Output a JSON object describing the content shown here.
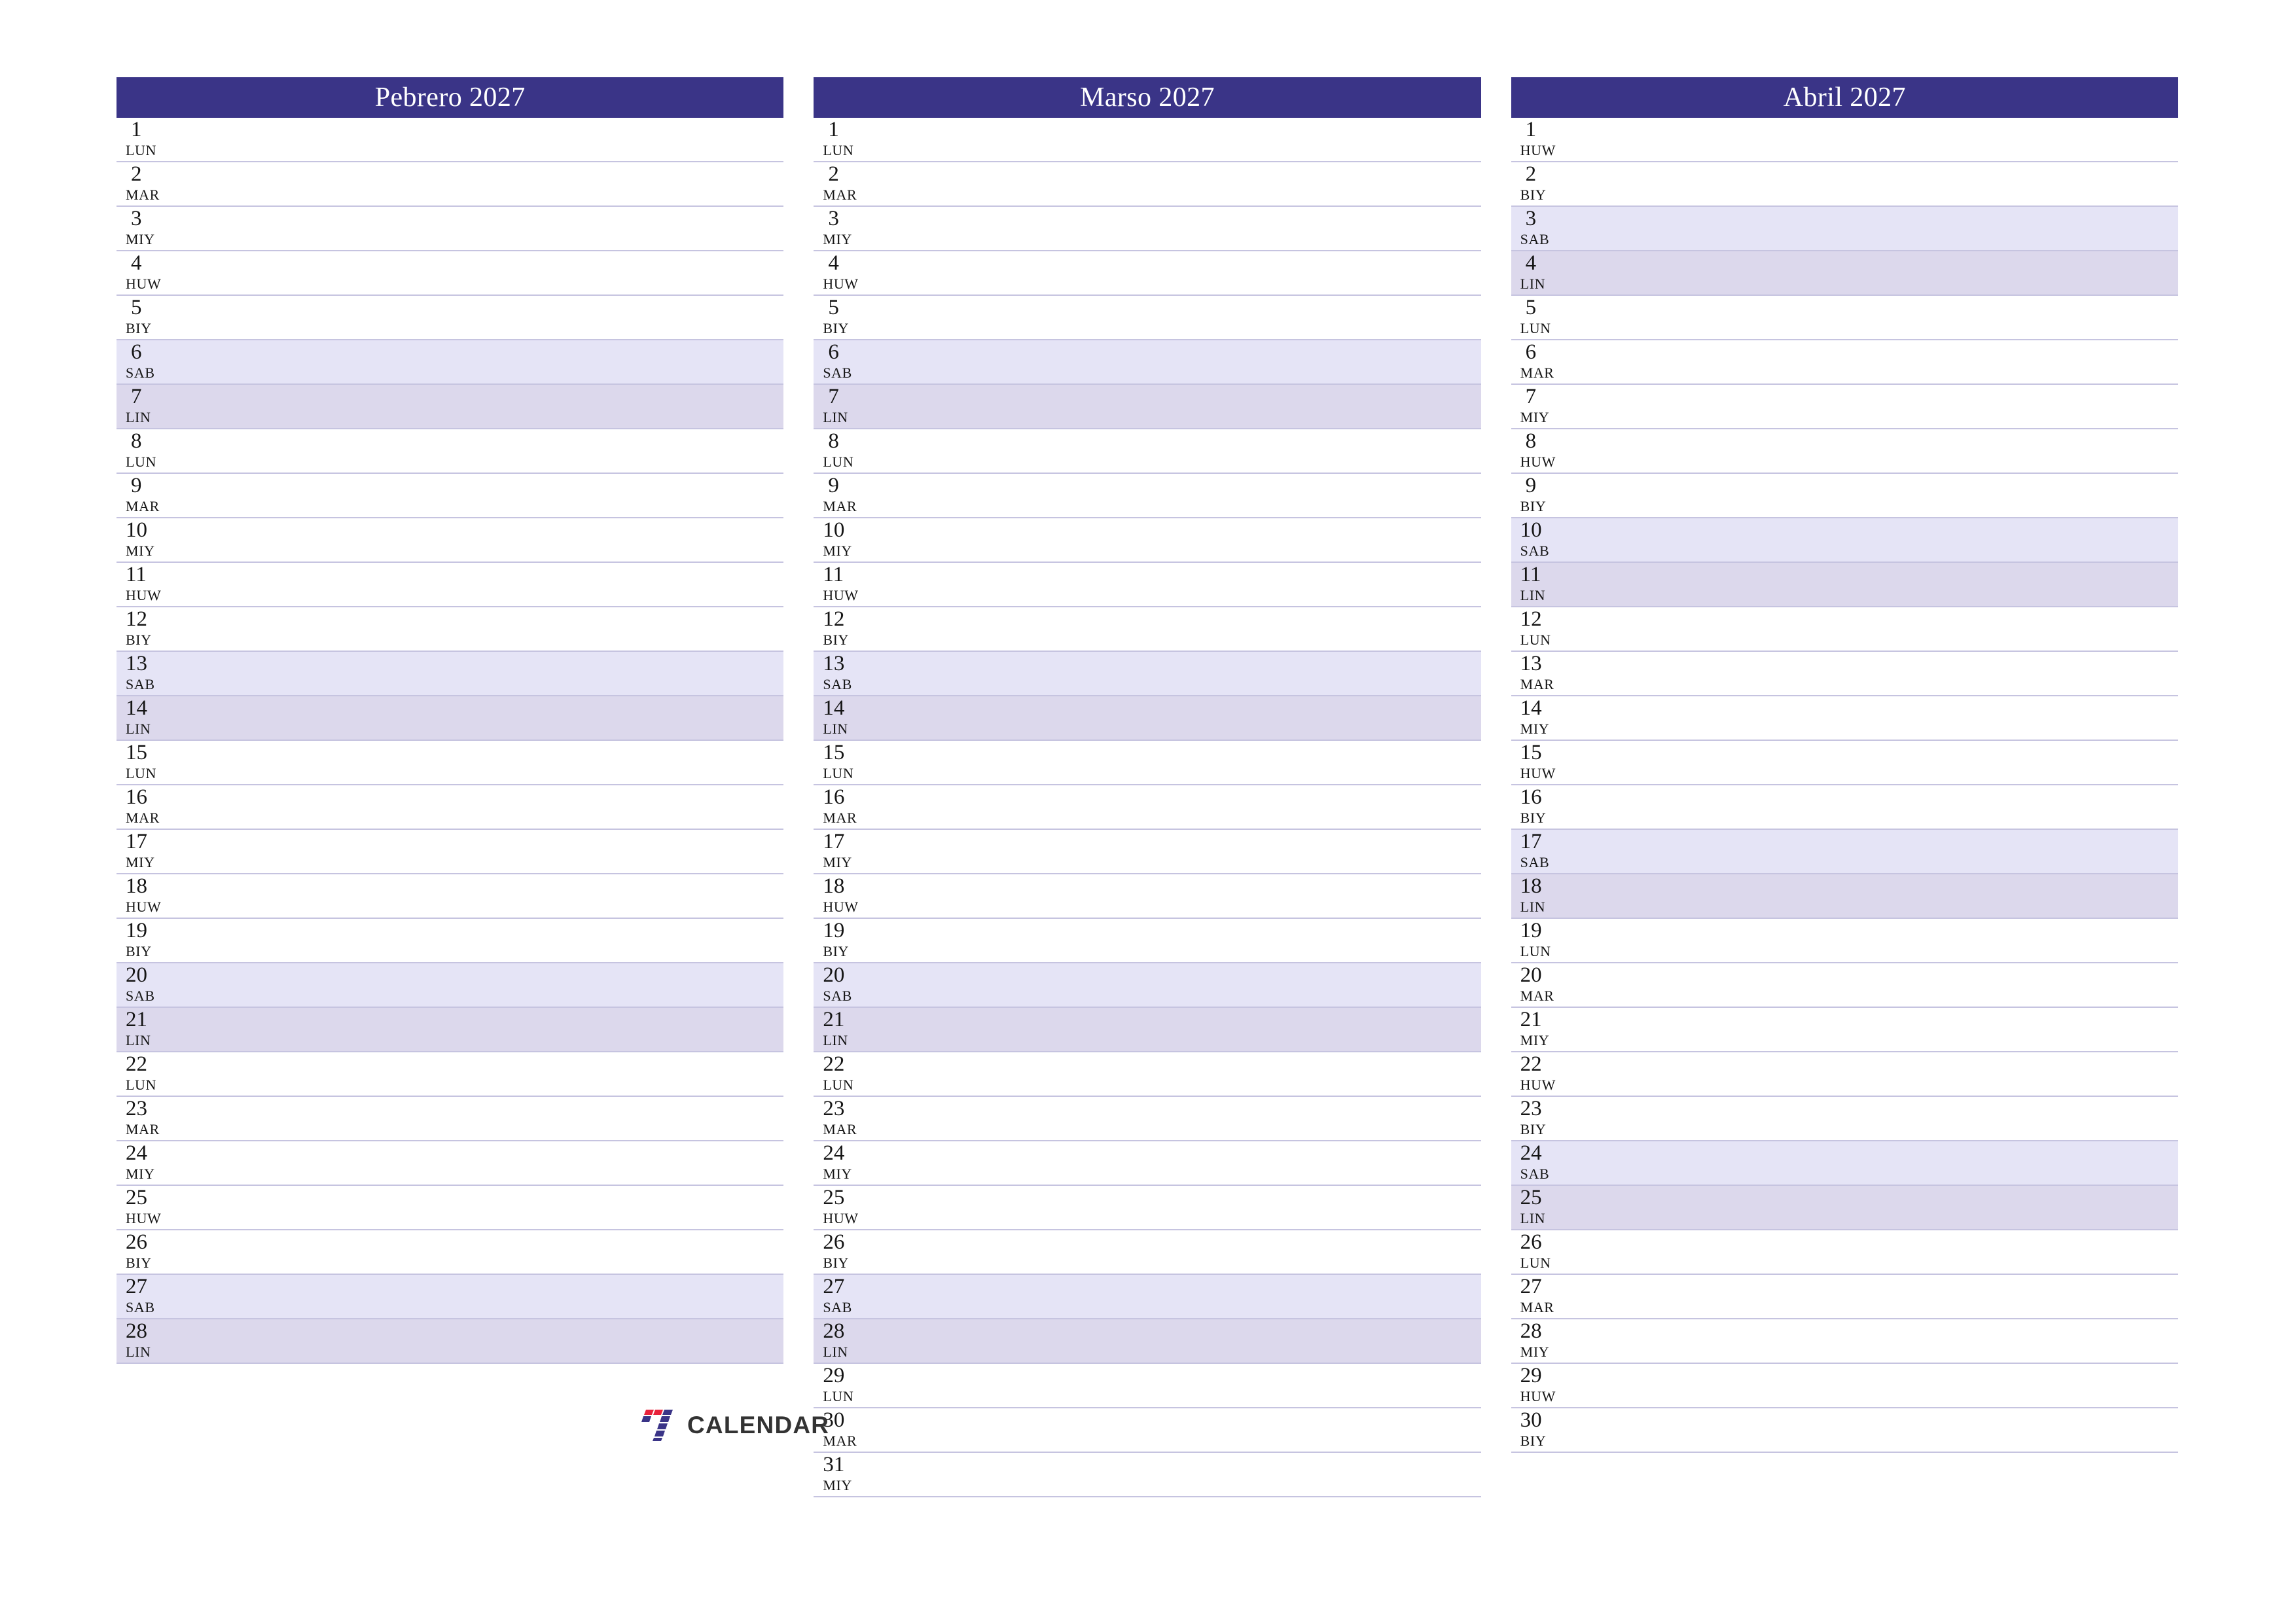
{
  "page": {
    "title": "Monthly Planner 2027",
    "language_note": "Filipino day abbreviations"
  },
  "colors": {
    "header_bg": "#3a3487",
    "header_text": "#ffffff",
    "saturday_bg": "#e5e4f6",
    "sunday_bg": "#dcd8ec",
    "row_rule": "#c6c4e0",
    "logo_red": "#e8213b",
    "logo_blue": "#3a3487",
    "logo_text": "#333333"
  },
  "weekday_abbreviations": [
    "LUN",
    "MAR",
    "MIY",
    "HUW",
    "BIY",
    "SAB",
    "LIN"
  ],
  "logo": {
    "mark_name": "seven-mark-icon",
    "text": "CALENDAR"
  },
  "months": [
    {
      "title": "Pebrero 2027",
      "days": [
        {
          "num": "1",
          "dow": "LUN"
        },
        {
          "num": "2",
          "dow": "MAR"
        },
        {
          "num": "3",
          "dow": "MIY"
        },
        {
          "num": "4",
          "dow": "HUW"
        },
        {
          "num": "5",
          "dow": "BIY"
        },
        {
          "num": "6",
          "dow": "SAB"
        },
        {
          "num": "7",
          "dow": "LIN"
        },
        {
          "num": "8",
          "dow": "LUN"
        },
        {
          "num": "9",
          "dow": "MAR"
        },
        {
          "num": "10",
          "dow": "MIY"
        },
        {
          "num": "11",
          "dow": "HUW"
        },
        {
          "num": "12",
          "dow": "BIY"
        },
        {
          "num": "13",
          "dow": "SAB"
        },
        {
          "num": "14",
          "dow": "LIN"
        },
        {
          "num": "15",
          "dow": "LUN"
        },
        {
          "num": "16",
          "dow": "MAR"
        },
        {
          "num": "17",
          "dow": "MIY"
        },
        {
          "num": "18",
          "dow": "HUW"
        },
        {
          "num": "19",
          "dow": "BIY"
        },
        {
          "num": "20",
          "dow": "SAB"
        },
        {
          "num": "21",
          "dow": "LIN"
        },
        {
          "num": "22",
          "dow": "LUN"
        },
        {
          "num": "23",
          "dow": "MAR"
        },
        {
          "num": "24",
          "dow": "MIY"
        },
        {
          "num": "25",
          "dow": "HUW"
        },
        {
          "num": "26",
          "dow": "BIY"
        },
        {
          "num": "27",
          "dow": "SAB"
        },
        {
          "num": "28",
          "dow": "LIN"
        }
      ]
    },
    {
      "title": "Marso 2027",
      "days": [
        {
          "num": "1",
          "dow": "LUN"
        },
        {
          "num": "2",
          "dow": "MAR"
        },
        {
          "num": "3",
          "dow": "MIY"
        },
        {
          "num": "4",
          "dow": "HUW"
        },
        {
          "num": "5",
          "dow": "BIY"
        },
        {
          "num": "6",
          "dow": "SAB"
        },
        {
          "num": "7",
          "dow": "LIN"
        },
        {
          "num": "8",
          "dow": "LUN"
        },
        {
          "num": "9",
          "dow": "MAR"
        },
        {
          "num": "10",
          "dow": "MIY"
        },
        {
          "num": "11",
          "dow": "HUW"
        },
        {
          "num": "12",
          "dow": "BIY"
        },
        {
          "num": "13",
          "dow": "SAB"
        },
        {
          "num": "14",
          "dow": "LIN"
        },
        {
          "num": "15",
          "dow": "LUN"
        },
        {
          "num": "16",
          "dow": "MAR"
        },
        {
          "num": "17",
          "dow": "MIY"
        },
        {
          "num": "18",
          "dow": "HUW"
        },
        {
          "num": "19",
          "dow": "BIY"
        },
        {
          "num": "20",
          "dow": "SAB"
        },
        {
          "num": "21",
          "dow": "LIN"
        },
        {
          "num": "22",
          "dow": "LUN"
        },
        {
          "num": "23",
          "dow": "MAR"
        },
        {
          "num": "24",
          "dow": "MIY"
        },
        {
          "num": "25",
          "dow": "HUW"
        },
        {
          "num": "26",
          "dow": "BIY"
        },
        {
          "num": "27",
          "dow": "SAB"
        },
        {
          "num": "28",
          "dow": "LIN"
        },
        {
          "num": "29",
          "dow": "LUN"
        },
        {
          "num": "30",
          "dow": "MAR"
        },
        {
          "num": "31",
          "dow": "MIY"
        }
      ]
    },
    {
      "title": "Abril 2027",
      "days": [
        {
          "num": "1",
          "dow": "HUW"
        },
        {
          "num": "2",
          "dow": "BIY"
        },
        {
          "num": "3",
          "dow": "SAB"
        },
        {
          "num": "4",
          "dow": "LIN"
        },
        {
          "num": "5",
          "dow": "LUN"
        },
        {
          "num": "6",
          "dow": "MAR"
        },
        {
          "num": "7",
          "dow": "MIY"
        },
        {
          "num": "8",
          "dow": "HUW"
        },
        {
          "num": "9",
          "dow": "BIY"
        },
        {
          "num": "10",
          "dow": "SAB"
        },
        {
          "num": "11",
          "dow": "LIN"
        },
        {
          "num": "12",
          "dow": "LUN"
        },
        {
          "num": "13",
          "dow": "MAR"
        },
        {
          "num": "14",
          "dow": "MIY"
        },
        {
          "num": "15",
          "dow": "HUW"
        },
        {
          "num": "16",
          "dow": "BIY"
        },
        {
          "num": "17",
          "dow": "SAB"
        },
        {
          "num": "18",
          "dow": "LIN"
        },
        {
          "num": "19",
          "dow": "LUN"
        },
        {
          "num": "20",
          "dow": "MAR"
        },
        {
          "num": "21",
          "dow": "MIY"
        },
        {
          "num": "22",
          "dow": "HUW"
        },
        {
          "num": "23",
          "dow": "BIY"
        },
        {
          "num": "24",
          "dow": "SAB"
        },
        {
          "num": "25",
          "dow": "LIN"
        },
        {
          "num": "26",
          "dow": "LUN"
        },
        {
          "num": "27",
          "dow": "MAR"
        },
        {
          "num": "28",
          "dow": "MIY"
        },
        {
          "num": "29",
          "dow": "HUW"
        },
        {
          "num": "30",
          "dow": "BIY"
        }
      ]
    }
  ]
}
